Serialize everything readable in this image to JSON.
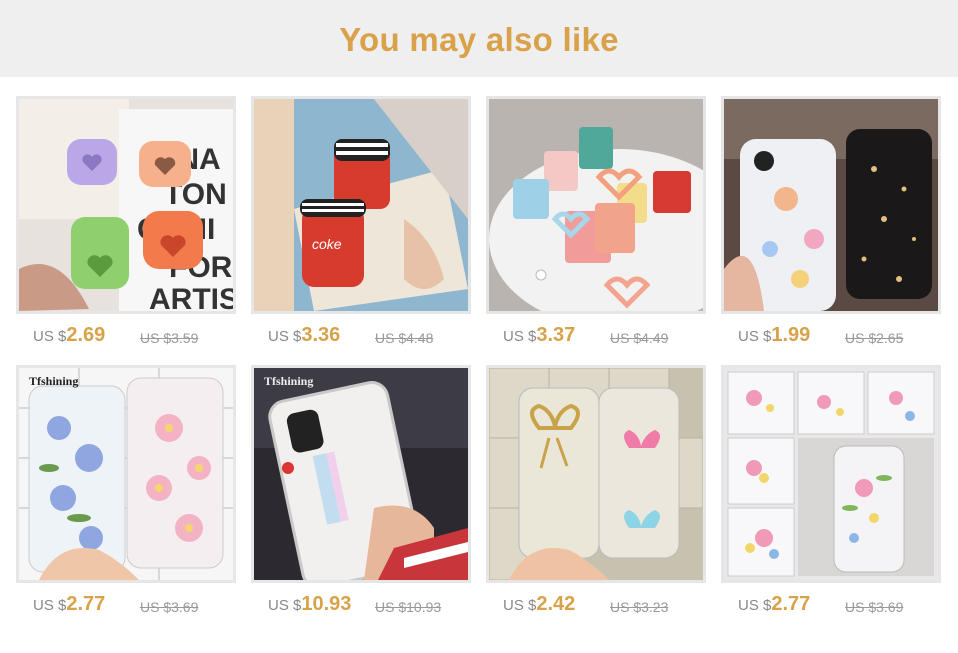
{
  "header": {
    "title": "You may also like"
  },
  "products": [
    {
      "currency": "US $",
      "price": "2.69",
      "old_price": "US $3.59",
      "image": "airpods-heart-cases-photo"
    },
    {
      "currency": "US $",
      "price": "3.36",
      "old_price": "US $4.48",
      "image": "airpods-cola-cup-case-photo"
    },
    {
      "currency": "US $",
      "price": "3.37",
      "old_price": "US $4.49",
      "image": "airpods-suitcase-cases-photo"
    },
    {
      "currency": "US $",
      "price": "1.99",
      "old_price": "US $2.65",
      "image": "glitter-planet-phone-case-photo"
    },
    {
      "currency": "US $",
      "price": "2.77",
      "old_price": "US $3.69",
      "image": "pressed-flower-phone-case-photo",
      "brand": "Tfshining"
    },
    {
      "currency": "US $",
      "price": "10.93",
      "old_price": "US $10.93",
      "image": "holographic-white-phone-case-photo",
      "brand": "Tfshining"
    },
    {
      "currency": "US $",
      "price": "2.42",
      "old_price": "US $3.23",
      "image": "bow-clear-phone-case-photo"
    },
    {
      "currency": "US $",
      "price": "2.77",
      "old_price": "US $3.69",
      "image": "flower-phone-case-collage-photo"
    }
  ],
  "colors": {
    "accent": "#d9a24a",
    "header_bg": "#efefef",
    "old_price": "#999999"
  }
}
